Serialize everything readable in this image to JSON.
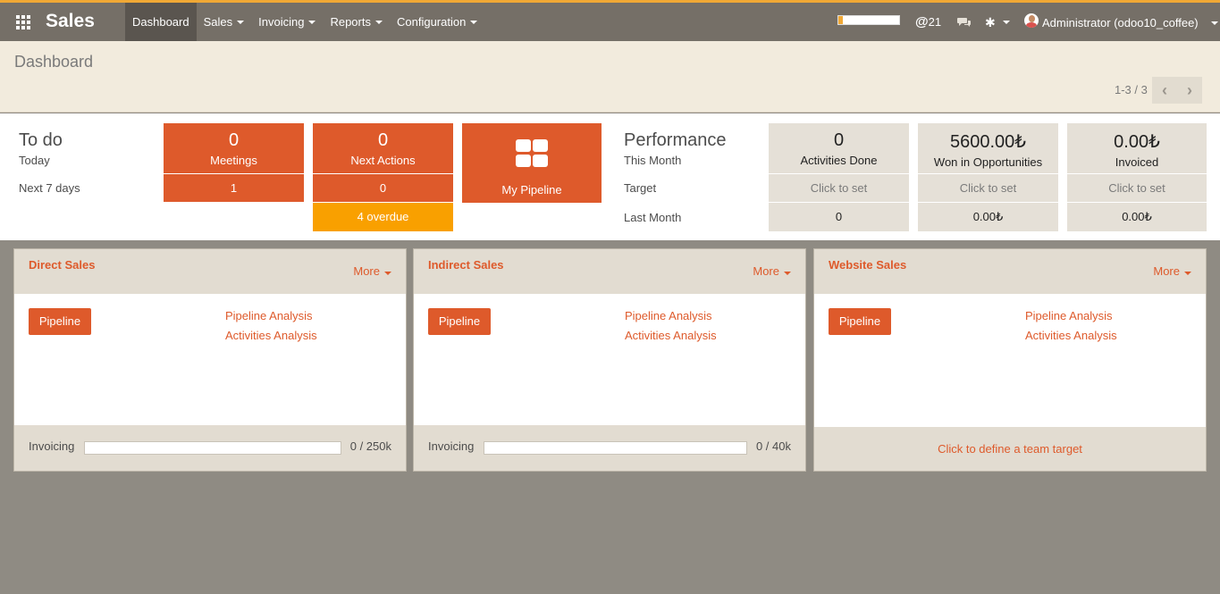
{
  "app": {
    "name": "Sales",
    "menu": [
      {
        "label": "Dashboard"
      },
      {
        "label": "Sales"
      },
      {
        "label": "Invoicing"
      },
      {
        "label": "Reports"
      },
      {
        "label": "Configuration"
      }
    ],
    "progress_fraction": 0.07,
    "mentions_count": "21",
    "user": "Administrator (odoo10_coffee)",
    "accent_color": "#de5a2b",
    "topbar_color": "#756f67"
  },
  "control": {
    "title": "Dashboard",
    "pager": "1-3 / 3"
  },
  "todo": {
    "title": "To do",
    "today_label": "Today",
    "next7_label": "Next 7 days",
    "meetings": {
      "value": "0",
      "label": "Meetings",
      "next7": "1"
    },
    "next_actions": {
      "value": "0",
      "label": "Next Actions",
      "next7": "0",
      "overdue": "4 overdue"
    },
    "pipeline": {
      "label": "My Pipeline"
    }
  },
  "performance": {
    "title": "Performance",
    "this_month_label": "This Month",
    "target_label": "Target",
    "last_month_label": "Last Month",
    "tiles": [
      {
        "value": "0",
        "label": "Activities Done",
        "target": "Click to set",
        "last": "0"
      },
      {
        "value": "5600.00₺",
        "label": "Won in Opportunities",
        "target": "Click to set",
        "last": "0.00₺"
      },
      {
        "value": "0.00₺",
        "label": "Invoiced",
        "target": "Click to set",
        "last": "0.00₺"
      }
    ]
  },
  "teams": [
    {
      "name": "Direct Sales",
      "more": "More",
      "pipeline_btn": "Pipeline",
      "link1": "Pipeline Analysis",
      "link2": "Activities Analysis",
      "foot_label": "Invoicing",
      "foot_value": "0 / 250k",
      "invoiced_fraction": 0
    },
    {
      "name": "Indirect Sales",
      "more": "More",
      "pipeline_btn": "Pipeline",
      "link1": "Pipeline Analysis",
      "link2": "Activities Analysis",
      "foot_label": "Invoicing",
      "foot_value": "0 / 40k",
      "invoiced_fraction": 0
    },
    {
      "name": "Website Sales",
      "more": "More",
      "pipeline_btn": "Pipeline",
      "link1": "Pipeline Analysis",
      "link2": "Activities Analysis",
      "foot_target": "Click to define a team target"
    }
  ]
}
